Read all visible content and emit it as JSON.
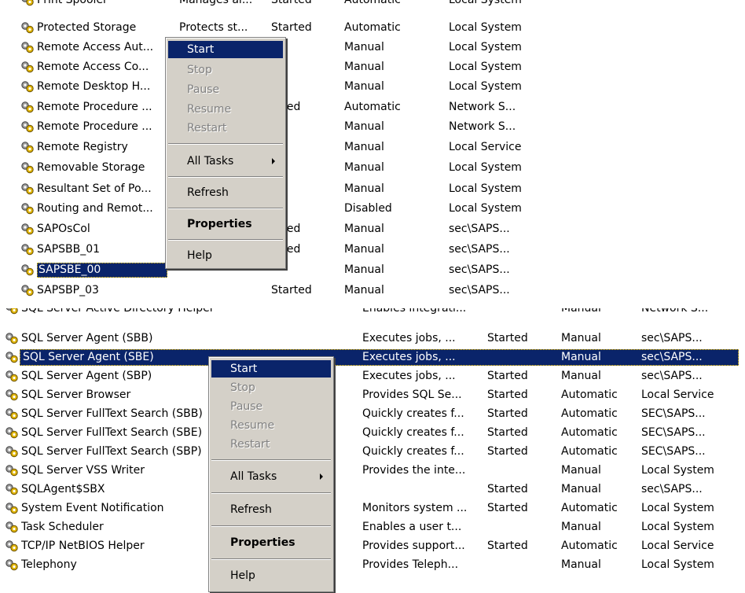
{
  "panel1": {
    "rows": [
      {
        "name": "Print Spooler",
        "desc": "Manages al...",
        "status": "Started",
        "startup": "Automatic",
        "logon": "Local System",
        "cut": true
      },
      {
        "name": "Protected Storage",
        "desc": "Protects st...",
        "status": "Started",
        "startup": "Automatic",
        "logon": "Local System"
      },
      {
        "name": "Remote Access Aut...",
        "desc": "",
        "status": "",
        "startup": "Manual",
        "logon": "Local System"
      },
      {
        "name": "Remote Access Co...",
        "desc": "",
        "status": "",
        "startup": "Manual",
        "logon": "Local System"
      },
      {
        "name": "Remote Desktop H...",
        "desc": "",
        "status": "",
        "startup": "Manual",
        "logon": "Local System"
      },
      {
        "name": "Remote Procedure ...",
        "desc": "",
        "status": "arted",
        "startup": "Automatic",
        "logon": "Network S..."
      },
      {
        "name": "Remote Procedure ...",
        "desc": "",
        "status": "",
        "startup": "Manual",
        "logon": "Network S..."
      },
      {
        "name": "Remote Registry",
        "desc": "",
        "status": "",
        "startup": "Manual",
        "logon": "Local Service"
      },
      {
        "name": "Removable Storage",
        "desc": "",
        "status": "",
        "startup": "Manual",
        "logon": "Local System"
      },
      {
        "name": "Resultant Set of Po...",
        "desc": "",
        "status": "",
        "startup": "Manual",
        "logon": "Local System"
      },
      {
        "name": "Routing and Remot...",
        "desc": "",
        "status": "",
        "startup": "Disabled",
        "logon": "Local System"
      },
      {
        "name": "SAPOsCol",
        "desc": "",
        "status": "arted",
        "startup": "Manual",
        "logon": "sec\\SAPS..."
      },
      {
        "name": "SAPSBB_01",
        "desc": "",
        "status": "arted",
        "startup": "Manual",
        "logon": "sec\\SAPS..."
      },
      {
        "name": "SAPSBE_00",
        "desc": "",
        "status": "",
        "startup": "Manual",
        "logon": "sec\\SAPS...",
        "selected": true
      },
      {
        "name": "SAPSBP_03",
        "desc": "",
        "status": "Started",
        "startup": "Manual",
        "logon": "sec\\SAPS..."
      }
    ],
    "menu": {
      "items": [
        "Start",
        "Stop",
        "Pause",
        "Resume",
        "Restart",
        "All Tasks",
        "Refresh",
        "Properties",
        "Help"
      ]
    }
  },
  "panel2": {
    "rows": [
      {
        "name": "SQL Server Active Directory Helper",
        "desc": "Enables integrati...",
        "status": "",
        "startup": "Manual",
        "logon": "Network S...",
        "cut": true
      },
      {
        "name": "SQL Server Agent (SBB)",
        "desc": "Executes jobs, ...",
        "status": "Started",
        "startup": "Manual",
        "logon": "sec\\SAPS..."
      },
      {
        "name": "SQL Server Agent (SBE)",
        "desc": "Executes jobs, ...",
        "status": "",
        "startup": "Manual",
        "logon": "sec\\SAPS...",
        "selected": true
      },
      {
        "name": "SQL Server Agent (SBP)",
        "desc": "Executes jobs, ...",
        "status": "Started",
        "startup": "Manual",
        "logon": "sec\\SAPS..."
      },
      {
        "name": "SQL Server Browser",
        "desc": "Provides SQL Se...",
        "status": "Started",
        "startup": "Automatic",
        "logon": "Local Service"
      },
      {
        "name": "SQL Server FullText Search (SBB)",
        "desc": "Quickly creates f...",
        "status": "Started",
        "startup": "Automatic",
        "logon": "SEC\\SAPS..."
      },
      {
        "name": "SQL Server FullText Search (SBE)",
        "desc": "Quickly creates f...",
        "status": "Started",
        "startup": "Automatic",
        "logon": "SEC\\SAPS..."
      },
      {
        "name": "SQL Server FullText Search (SBP)",
        "desc": "Quickly creates f...",
        "status": "Started",
        "startup": "Automatic",
        "logon": "SEC\\SAPS..."
      },
      {
        "name": "SQL Server VSS Writer",
        "desc": "Provides the inte...",
        "status": "",
        "startup": "Manual",
        "logon": "Local System"
      },
      {
        "name": "SQLAgent$SBX",
        "desc": "",
        "status": "Started",
        "startup": "Manual",
        "logon": "sec\\SAPS..."
      },
      {
        "name": "System Event Notification",
        "desc": "Monitors system ...",
        "status": "Started",
        "startup": "Automatic",
        "logon": "Local System"
      },
      {
        "name": "Task Scheduler",
        "desc": "Enables a user t...",
        "status": "",
        "startup": "Manual",
        "logon": "Local System"
      },
      {
        "name": "TCP/IP NetBIOS Helper",
        "desc": "Provides support...",
        "status": "Started",
        "startup": "Automatic",
        "logon": "Local Service"
      },
      {
        "name": "Telephony",
        "desc": "Provides Teleph...",
        "status": "",
        "startup": "Manual",
        "logon": "Local System"
      }
    ],
    "menu": {
      "items": [
        "Start",
        "Stop",
        "Pause",
        "Resume",
        "Restart",
        "All Tasks",
        "Refresh",
        "Properties",
        "Help"
      ]
    }
  }
}
